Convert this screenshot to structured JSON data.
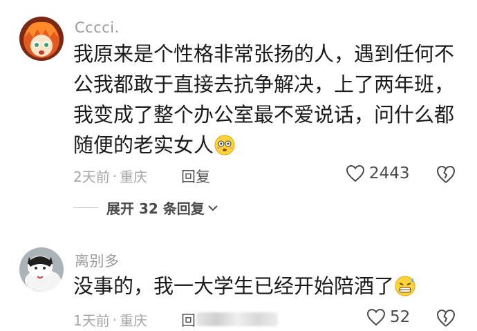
{
  "comments": [
    {
      "username": "Cccci.",
      "text": "我原来是个性格非常张扬的人，遇到任何不公我都敢于直接去抗争解决，上了两年班，我变成了整个办公室最不爱说话，问什么都随便的老实女人",
      "time": "2天前",
      "separator": "·",
      "location": "重庆",
      "reply_label": "回复",
      "likes": "2443",
      "emoji": "flushed-face-icon",
      "replies_expand": "展开 32 条回复"
    },
    {
      "username": "离别多",
      "text": "没事的，我一大学生已经开始陪酒了",
      "time": "1天前",
      "separator": "·",
      "location": "重庆",
      "reply_label": "回",
      "likes": "52",
      "emoji": "grimacing-sweat-face-icon"
    }
  ],
  "colors": {
    "username": "#9a9a9a",
    "body": "#1a1a1a",
    "meta": "#a6a6a6"
  }
}
